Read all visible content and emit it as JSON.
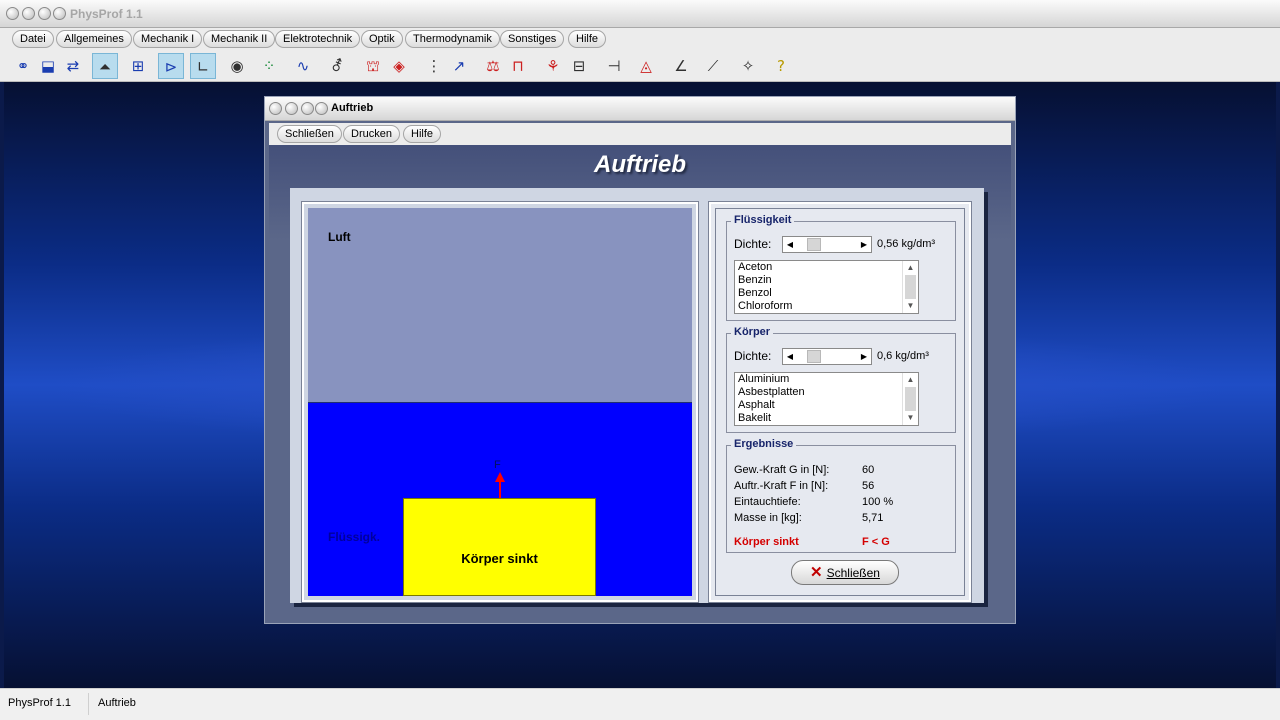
{
  "app": {
    "title": "PhysProf 1.1"
  },
  "menu": [
    "Datei",
    "Allgemeines",
    "Mechanik I",
    "Mechanik II",
    "Elektrotechnik",
    "Optik",
    "Thermodynamik",
    "Sonstiges",
    "Hilfe"
  ],
  "toolbar": {
    "icons": [
      "atoms-icon",
      "stack-icon",
      "swap-icon",
      "wave-icon",
      "balance-icon",
      "vector-icon",
      "axes-icon",
      "eye-icon",
      "grid-icon",
      "oscillation-icon",
      "rotation-icon",
      "magnet-icon",
      "pressure-icon",
      "lever-icon",
      "graph-icon",
      "scale-icon",
      "frame-icon",
      "molecule-icon",
      "battery-icon",
      "resistor-icon",
      "lens-icon",
      "spectrum-icon",
      "decay-icon",
      "curve-icon",
      "help-icon"
    ],
    "glyphs": [
      "⚭",
      "⬓",
      "⇄",
      "⏶",
      "⊞",
      "⊳",
      "∟",
      "◉",
      "⁘",
      "∿",
      "⚦",
      "⛫",
      "◈",
      "⋮",
      "↗",
      "⚖",
      "⊓",
      "⚘",
      "⊟",
      "⊣",
      "◬",
      "∠",
      "⟋",
      "✧",
      "?"
    ]
  },
  "dialog": {
    "title": "Auftrieb",
    "menu": [
      "Schließen",
      "Drucken",
      "Hilfe"
    ],
    "heading": "Auftrieb"
  },
  "simulation": {
    "air_label": "Luft",
    "liquid_label": "Flüssigk.",
    "force_label": "F",
    "body_label": "Körper sinkt",
    "colors": {
      "air": "#8893bf",
      "liquid": "#0000ff",
      "body": "#ffff00",
      "arrow": "#ff0000"
    }
  },
  "fluid": {
    "group_title": "Flüssigkeit",
    "density_label": "Dichte:",
    "density_value": "0,56 kg/dm³",
    "items": [
      "Aceton",
      "Benzin",
      "Benzol",
      "Chloroform"
    ]
  },
  "solid": {
    "group_title": "Körper",
    "density_label": "Dichte:",
    "density_value": "0,6 kg/dm³",
    "items": [
      "Aluminium",
      "Asbestplatten",
      "Asphalt",
      "Bakelit"
    ]
  },
  "results": {
    "group_title": "Ergebnisse",
    "rows": [
      {
        "label": "Gew.-Kraft G in [N]:",
        "value": "60"
      },
      {
        "label": "Auftr.-Kraft F in [N]:",
        "value": "56"
      },
      {
        "label": "Eintauchtiefe:",
        "value": "100 %"
      },
      {
        "label": "Masse in [kg]:",
        "value": "5,71"
      }
    ],
    "status_label": "Körper sinkt",
    "status_value": "F < G"
  },
  "close_button": "Schließen",
  "statusbar": {
    "app": "PhysProf 1.1",
    "document": "Auftrieb"
  }
}
